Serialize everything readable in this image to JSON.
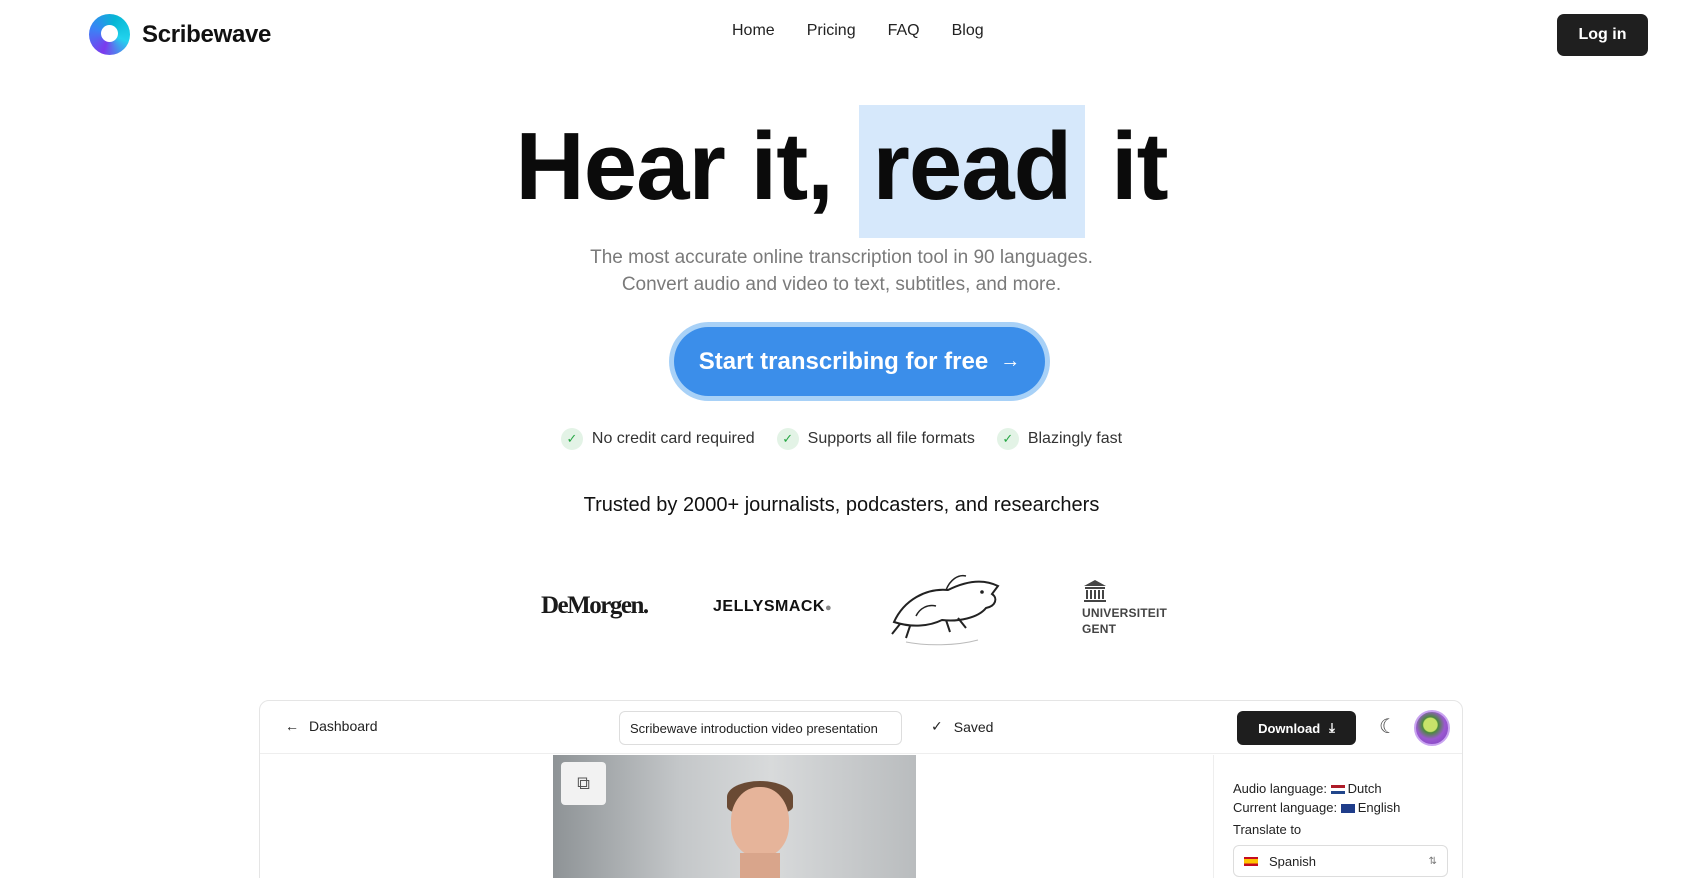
{
  "header": {
    "brand": "Scribewave",
    "nav": [
      "Home",
      "Pricing",
      "FAQ",
      "Blog"
    ],
    "login_label": "Log in"
  },
  "hero": {
    "title_part1": "Hear it,",
    "title_highlight": "read",
    "title_part2": "it",
    "subtitle_line1": "The most accurate online transcription tool in 90 languages.",
    "subtitle_line2": "Convert audio and video to text, subtitles, and more.",
    "cta_label": "Start transcribing for free",
    "features": [
      "No credit card required",
      "Supports all file formats",
      "Blazingly fast"
    ],
    "trusted_text": "Trusted by 2000+ journalists, podcasters, and researchers"
  },
  "logos": {
    "demorgen": "DeMorgen.",
    "jellysmack": "JELLYSMACK",
    "ugent_line1": "UNIVERSITEIT",
    "ugent_line2": "GENT"
  },
  "app_preview": {
    "back_label": "Dashboard",
    "title_value": "Scribewave introduction video presentation",
    "saved_label": "Saved",
    "download_label": "Download",
    "audio_language_label": "Audio language:",
    "audio_language_value": "Dutch",
    "current_language_label": "Current language:",
    "current_language_value": "English",
    "translate_label": "Translate to",
    "translate_value": "Spanish"
  },
  "colors": {
    "accent": "#3b8eea",
    "highlight": "#d6e8fb",
    "dark_button": "#1f1f1f",
    "check_green": "#28a745"
  }
}
